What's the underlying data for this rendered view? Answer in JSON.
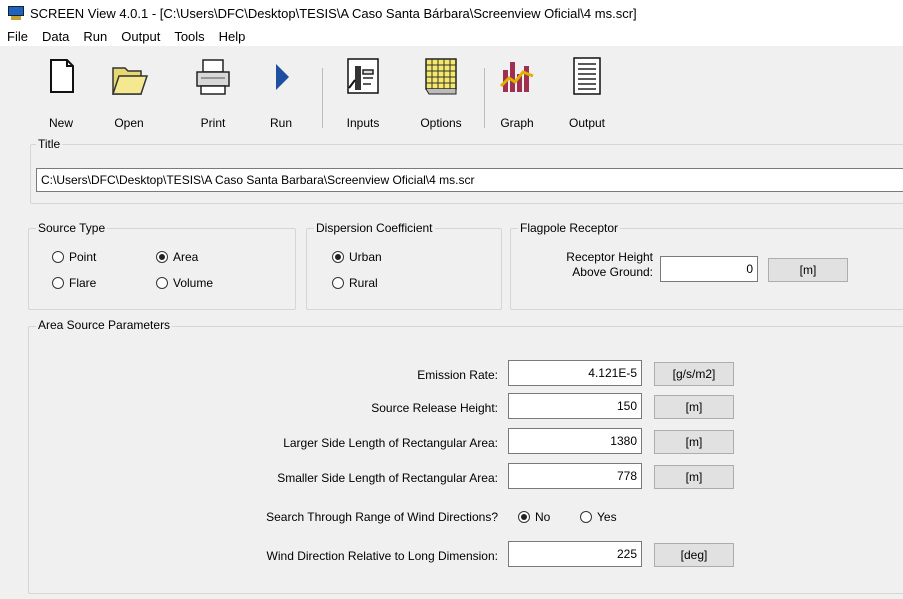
{
  "window": {
    "title": "SCREEN View 4.0.1 - [C:\\Users\\DFC\\Desktop\\TESIS\\A Caso Santa Bárbara\\Screenview Oficial\\4 ms.scr]"
  },
  "menu": [
    "File",
    "Data",
    "Run",
    "Output",
    "Tools",
    "Help"
  ],
  "toolbar": {
    "new": "New",
    "open": "Open",
    "print": "Print",
    "run": "Run",
    "inputs": "Inputs",
    "options": "Options",
    "graph": "Graph",
    "output": "Output"
  },
  "title_section": {
    "label": "Title",
    "value": "C:\\Users\\DFC\\Desktop\\TESIS\\A Caso Santa Barbara\\Screenview Oficial\\4 ms.scr"
  },
  "source_type": {
    "label": "Source Type",
    "point": "Point",
    "area": "Area",
    "flare": "Flare",
    "volume": "Volume",
    "selected": "Area"
  },
  "dispersion": {
    "label": "Dispersion Coefficient",
    "urban": "Urban",
    "rural": "Rural",
    "selected": "Urban"
  },
  "flagpole": {
    "label": "Flagpole Receptor",
    "height_label_1": "Receptor Height",
    "height_label_2": "Above Ground:",
    "height_value": "0",
    "unit": "[m]"
  },
  "area_params": {
    "label": "Area Source Parameters",
    "emission_rate": {
      "label": "Emission Rate:",
      "value": "4.121E-5",
      "unit": "[g/s/m2]"
    },
    "release_height": {
      "label": "Source Release Height:",
      "value": "150",
      "unit": "[m]"
    },
    "larger_side": {
      "label": "Larger Side Length of Rectangular Area:",
      "value": "1380",
      "unit": "[m]"
    },
    "smaller_side": {
      "label": "Smaller Side Length of Rectangular Area:",
      "value": "778",
      "unit": "[m]"
    },
    "wind_search": {
      "label": "Search Through Range of Wind Directions?",
      "no": "No",
      "yes": "Yes",
      "selected": "No"
    },
    "wind_direction": {
      "label": "Wind Direction Relative to Long Dimension:",
      "value": "225",
      "unit": "[deg]"
    }
  }
}
